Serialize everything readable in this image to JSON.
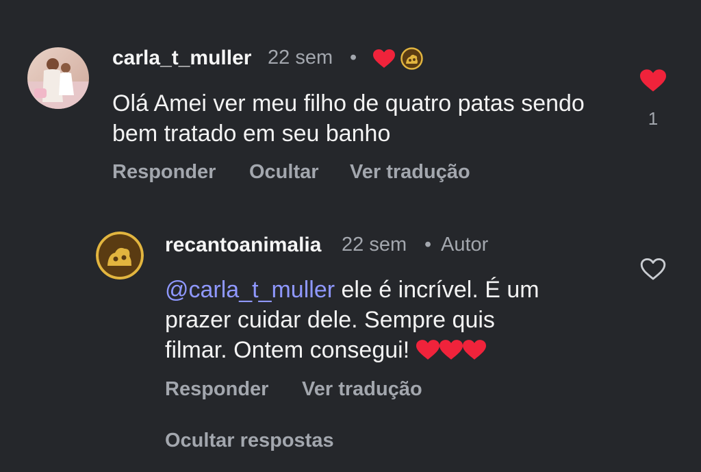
{
  "colors": {
    "background": "#25272b",
    "heart_red": "#f0233b",
    "mention": "#8f98ff",
    "muted": "#a3a7ae",
    "brand_gold": "#e2b53f",
    "brand_brown": "#5a3b12"
  },
  "comment": {
    "username": "carla_t_muller",
    "time": "22 sem",
    "dot": "•",
    "text": "Olá Amei ver meu filho de quatro patas sendo bem tratado em seu banho",
    "like_count": "1",
    "actions": {
      "reply": "Responder",
      "hide": "Ocultar",
      "translate": "Ver tradução"
    },
    "icons": {
      "author_liked": "heart-icon",
      "author_badge": "brand-avatar-icon",
      "like": "heart-filled-icon"
    }
  },
  "reply": {
    "username": "recantoanimalia",
    "time": "22 sem",
    "dot": "•",
    "author_tag": "Autor",
    "mention": "@carla_t_muller",
    "text_line1_rest": " ele é incrível. É um",
    "text_line2": "prazer cuidar dele. Sempre quis",
    "text_line3": "filmar. Ontem consegui! ",
    "emoji": "❤️❤️❤️",
    "actions": {
      "reply": "Responder",
      "translate": "Ver tradução"
    },
    "icons": {
      "like": "heart-outline-icon"
    }
  },
  "hide_replies": "Ocultar respostas"
}
